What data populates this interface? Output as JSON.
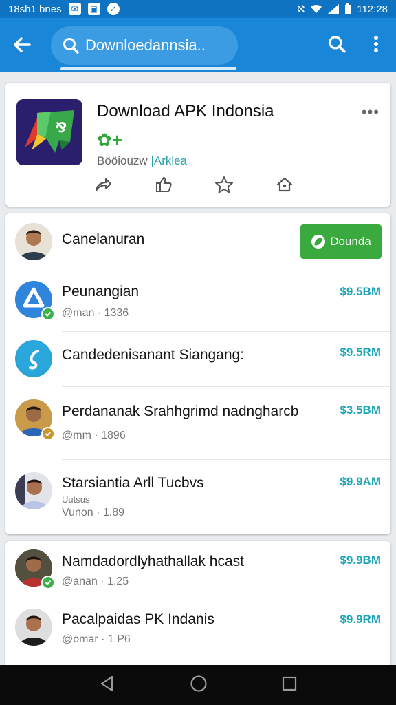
{
  "status_bar": {
    "left_text": "18sh1 bnes",
    "time": "112:28"
  },
  "search": {
    "query": "Downloedannsia.."
  },
  "app": {
    "title": "Download APK Indonsia",
    "rating_symbol": "✿+",
    "meta_prefix": "Bööiouzw ",
    "meta_tag": "|Arklea",
    "more_label": "•••"
  },
  "list_main": [
    {
      "title": "Canelanuran",
      "button_label": "Dounda"
    },
    {
      "title": "Peunangian",
      "subtitle": "@man · 1336",
      "price": "$9.5BM"
    },
    {
      "title": "Candedenisanant Siangang:",
      "price": "$9.5RM"
    },
    {
      "title": "Perdananak Srahhgrimd nadngharcb",
      "subtitle": "@mm · 1896",
      "price": "$3.5BM"
    },
    {
      "title": "Starsiantia Arll Tucbvs",
      "subtitle": "Uutsus",
      "subtitle2": "Vunon · 1.89",
      "price": "$9.9AM"
    }
  ],
  "list_more": [
    {
      "title": "Namdadordlyhathallak hcast",
      "subtitle": "@anan · 1.25",
      "price": "$9.9BM"
    },
    {
      "title": "Pacalpaidas PK Indanis",
      "subtitle": "@omar · 1 P6",
      "price": "$9.9RM"
    }
  ],
  "colors": {
    "primary": "#1a86d8",
    "accent_green": "#3aaa3f",
    "price_teal": "#1fa4b8"
  }
}
